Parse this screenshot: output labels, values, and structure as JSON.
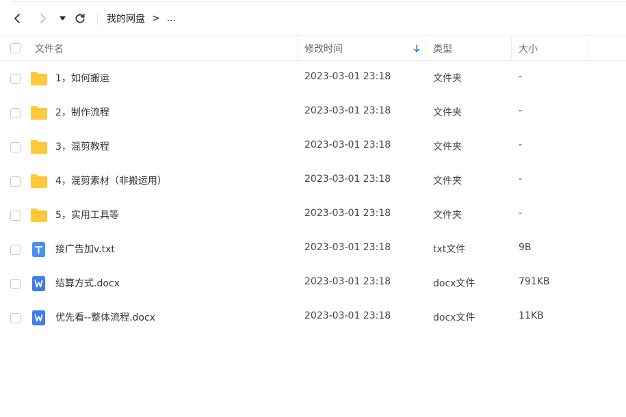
{
  "toolbar": {
    "back_icon": "chevron-left-icon",
    "forward_icon": "chevron-right-icon",
    "dropdown_icon": "caret-down-icon",
    "refresh_icon": "refresh-icon"
  },
  "breadcrumb": {
    "root": "我的网盘",
    "separator": ">",
    "more": "..."
  },
  "columns": {
    "name": "文件名",
    "modified": "修改时间",
    "type": "类型",
    "size": "大小",
    "sort_icon": "sort-descending-arrow-icon"
  },
  "colors": {
    "folder": "#ffc93c",
    "txt_icon": "#4a90f0",
    "doc_icon": "#3f7de8",
    "sort_arrow": "#1e88e5"
  },
  "files": [
    {
      "name": "1，如何搬运",
      "modified": "2023-03-01 23:18",
      "type": "文件夹",
      "size": "-",
      "icon": "folder-icon"
    },
    {
      "name": "2，制作流程",
      "modified": "2023-03-01 23:18",
      "type": "文件夹",
      "size": "-",
      "icon": "folder-icon"
    },
    {
      "name": "3，混剪教程",
      "modified": "2023-03-01 23:18",
      "type": "文件夹",
      "size": "-",
      "icon": "folder-icon"
    },
    {
      "name": "4，混剪素材（非搬运用）",
      "modified": "2023-03-01 23:18",
      "type": "文件夹",
      "size": "-",
      "icon": "folder-icon"
    },
    {
      "name": "5，实用工具等",
      "modified": "2023-03-01 23:18",
      "type": "文件夹",
      "size": "-",
      "icon": "folder-icon"
    },
    {
      "name": "接广告加v.txt",
      "modified": "2023-03-01 23:18",
      "type": "txt文件",
      "size": "9B",
      "icon": "txt-file-icon"
    },
    {
      "name": "结算方式.docx",
      "modified": "2023-03-01 23:18",
      "type": "docx文件",
      "size": "791KB",
      "icon": "word-doc-icon"
    },
    {
      "name": "优先看--整体流程.docx",
      "modified": "2023-03-01 23:18",
      "type": "docx文件",
      "size": "11KB",
      "icon": "word-doc-icon"
    }
  ]
}
